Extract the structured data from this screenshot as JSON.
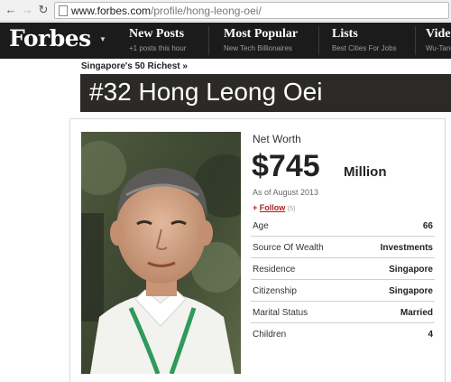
{
  "browser": {
    "url_host": "www.forbes.com",
    "url_path": "/profile/hong-leong-oei/"
  },
  "header": {
    "logo": "Forbes",
    "nav": [
      {
        "title": "New Posts",
        "subtitle": "+1 posts this hour"
      },
      {
        "title": "Most Popular",
        "subtitle": "New Tech Billionaires"
      },
      {
        "title": "Lists",
        "subtitle": "Best Cities For Jobs"
      },
      {
        "title": "Video",
        "subtitle": "Wu-Tang"
      }
    ]
  },
  "breadcrumb": "Singapore's 50 Richest »",
  "profile": {
    "title": "#32 Hong Leong Oei",
    "net_worth_label": "Net Worth",
    "net_worth_value": "$745",
    "net_worth_unit": "Million",
    "as_of": "As of August 2013",
    "follow_label": "Follow",
    "follow_count": "(5)",
    "stats": [
      {
        "label": "Age",
        "value": "66"
      },
      {
        "label": "Source Of Wealth",
        "value": "Investments"
      },
      {
        "label": "Residence",
        "value": "Singapore"
      },
      {
        "label": "Citizenship",
        "value": "Singapore"
      },
      {
        "label": "Marital Status",
        "value": "Married"
      },
      {
        "label": "Children",
        "value": "4"
      }
    ]
  },
  "colors": {
    "header_bg": "#1b1b1b",
    "title_bar_bg": "#2c2a27",
    "follow_red": "#b31b1b"
  }
}
